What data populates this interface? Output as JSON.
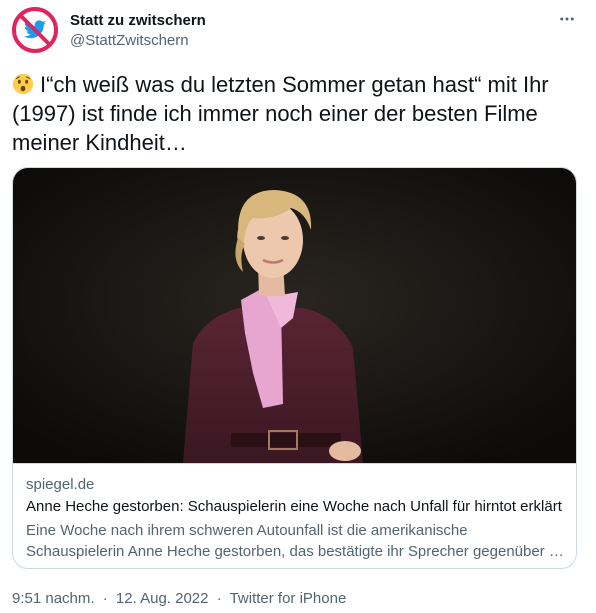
{
  "author": {
    "name": "Statt zu zwitschern",
    "handle": "@StattZwitschern",
    "avatar_icon": "no-twitter-bird-icon"
  },
  "more_icon": "more-horizontal-icon",
  "tweet": {
    "emoji": "astonished-face-emoji",
    "text": "I“ch weiß was du letzten Sommer getan hast“ mit Ihr (1997) ist finde ich immer noch einer der besten Filme meiner Kindheit…"
  },
  "card": {
    "domain": "spiegel.de",
    "title": "Anne Heche gestorben: Schauspielerin eine Woche nach Unfall für hirntot erklärt",
    "description_line1": "Eine Woche nach ihrem schweren Autounfall ist die amerikanische",
    "description_line2": "Schauspielerin Anne Heche gestorben, das bestätigte ihr Sprecher gegenüber …"
  },
  "meta": {
    "time": "9:51 nachm.",
    "separator": "·",
    "date": "12. Aug. 2022",
    "source": "Twitter for iPhone"
  },
  "colors": {
    "text": "#0f1419",
    "secondary": "#536471",
    "border": "#cfd9de",
    "twitter_blue": "#1d9bf0",
    "forbidden_red": "#e0245e"
  }
}
